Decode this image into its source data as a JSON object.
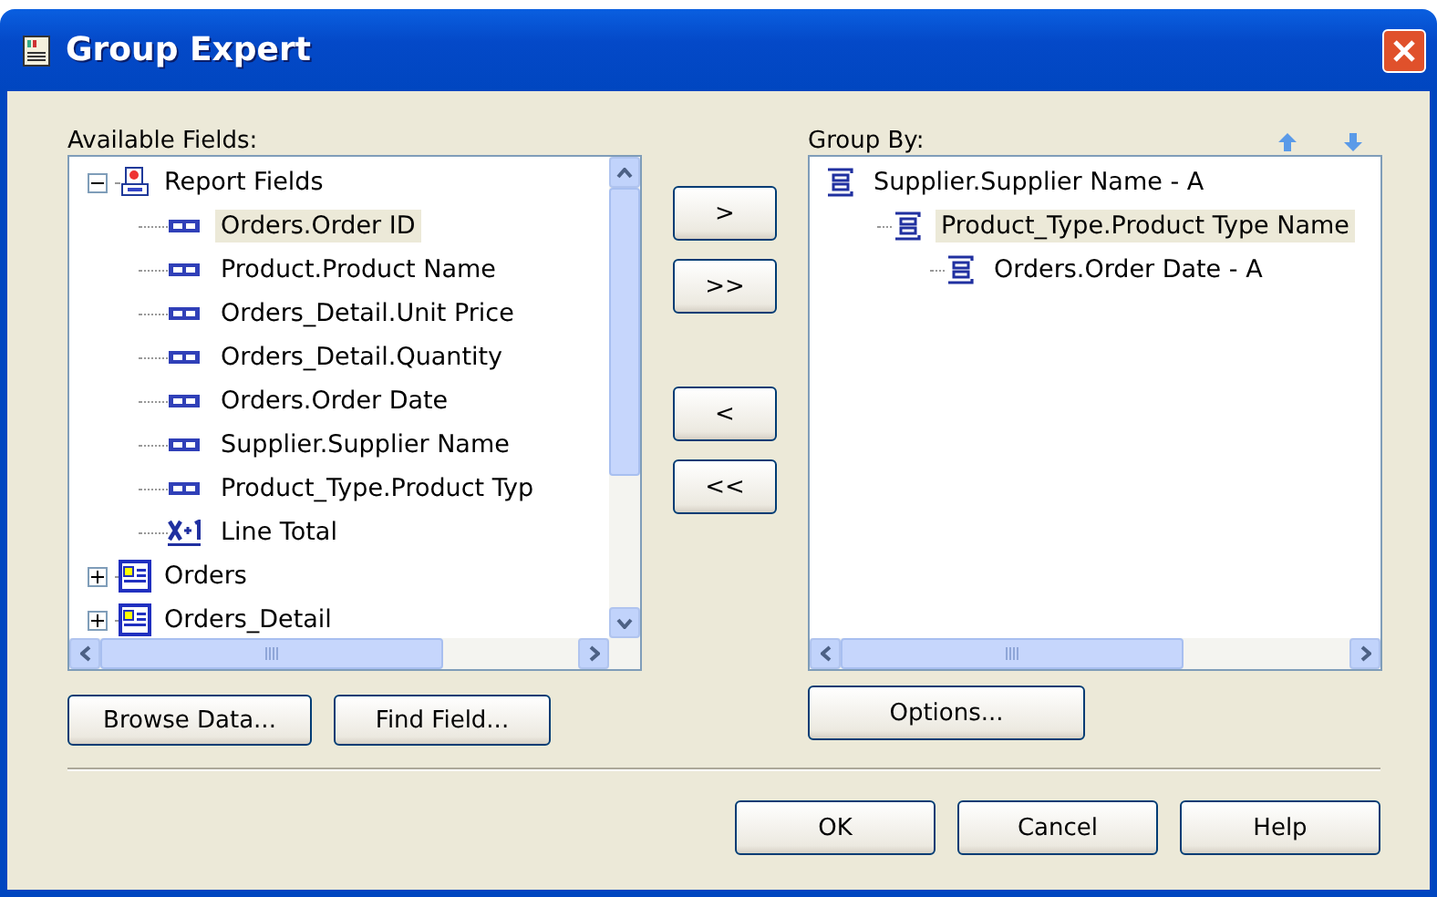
{
  "window": {
    "title": "Group Expert"
  },
  "available": {
    "label": "Available Fields:",
    "tree": [
      {
        "label": "Report Fields",
        "kind": "folder",
        "expanded": true,
        "selected": false,
        "children": [
          {
            "label": "Orders.Order ID",
            "kind": "field",
            "selected": true
          },
          {
            "label": "Product.Product Name",
            "kind": "field",
            "selected": false
          },
          {
            "label": "Orders_Detail.Unit Price",
            "kind": "field",
            "selected": false
          },
          {
            "label": "Orders_Detail.Quantity",
            "kind": "field",
            "selected": false
          },
          {
            "label": "Orders.Order Date",
            "kind": "field",
            "selected": false
          },
          {
            "label": "Supplier.Supplier Name",
            "kind": "field",
            "selected": false
          },
          {
            "label": "Product_Type.Product Typ",
            "kind": "field",
            "selected": false
          },
          {
            "label": "Line Total",
            "kind": "formula",
            "selected": false
          }
        ]
      },
      {
        "label": "Orders",
        "kind": "table",
        "expanded": false,
        "selected": false
      },
      {
        "label": "Orders_Detail",
        "kind": "table",
        "expanded": false,
        "selected": false
      }
    ],
    "buttons": [
      "Browse Data...",
      "Find Field..."
    ]
  },
  "move_buttons": [
    ">",
    ">>",
    "<",
    "<<"
  ],
  "group_by": {
    "label": "Group By:",
    "tree": [
      {
        "label": "Supplier.Supplier Name - A",
        "selected": false,
        "children": [
          {
            "label": "Product_Type.Product Type Name",
            "selected": true,
            "children": [
              {
                "label": "Orders.Order Date - A",
                "selected": false
              }
            ]
          }
        ]
      }
    ],
    "button": "Options..."
  },
  "buttons": [
    "OK",
    "Cancel",
    "Help"
  ]
}
